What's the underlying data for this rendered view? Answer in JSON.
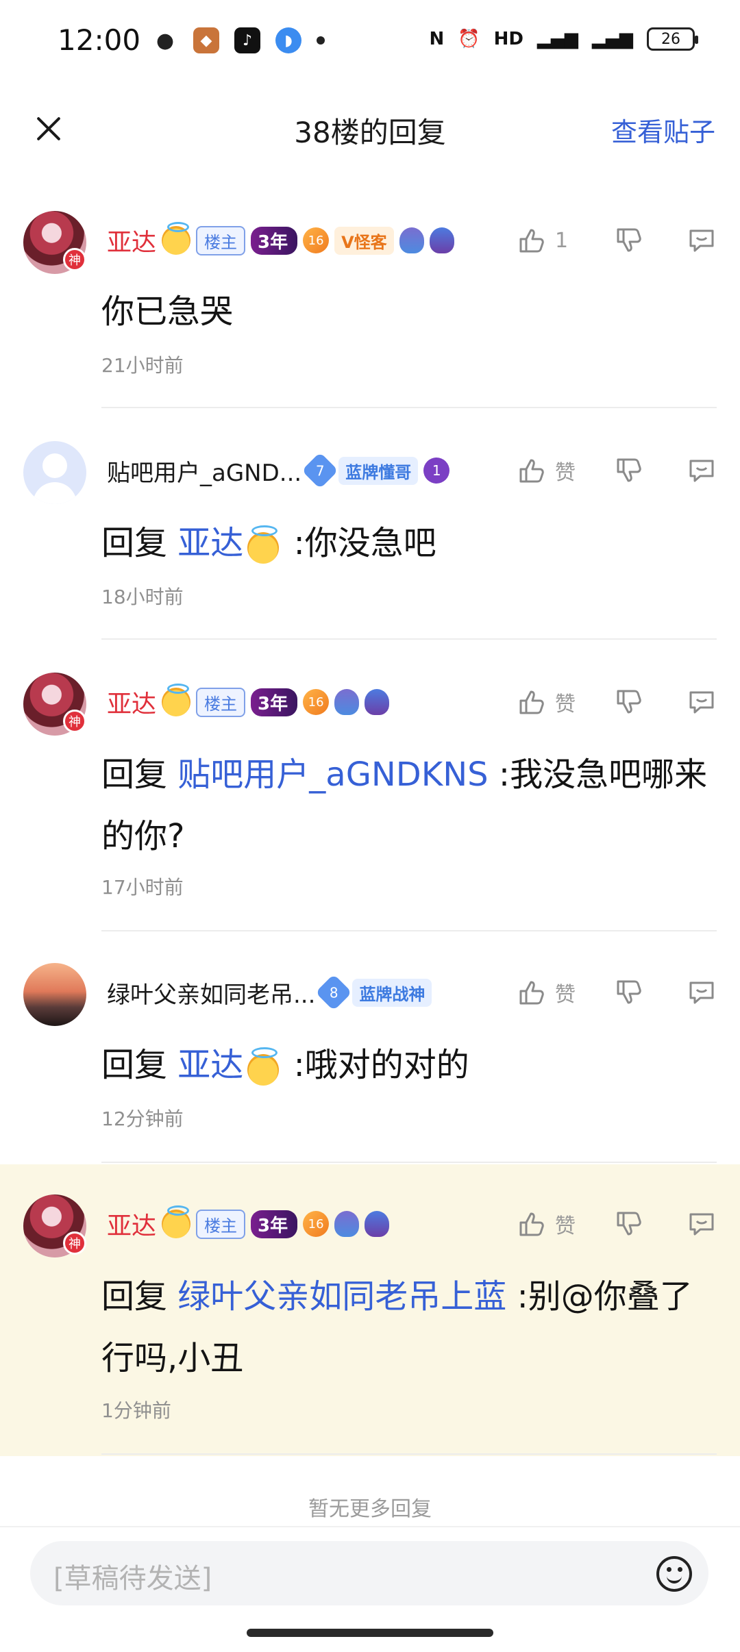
{
  "status_bar": {
    "time": "12:00",
    "battery": "26"
  },
  "header": {
    "title": "38楼的回复",
    "view_post": "查看贴子"
  },
  "replies": [
    {
      "user": "亚达",
      "god_badge": "神",
      "louzhu": "楼主",
      "years": "3年",
      "level": "16",
      "title_tag": "V怪客",
      "like": "1",
      "text": "你已急哭",
      "time": "21小时前"
    },
    {
      "user": "贴吧用户_aGND...",
      "level": "7",
      "title_tag": "蓝牌懂哥",
      "badge_num": "1",
      "like": "赞",
      "reply_prefix": "回复",
      "mention": "亚达",
      "text": ":你没急吧",
      "time": "18小时前"
    },
    {
      "user": "亚达",
      "god_badge": "神",
      "louzhu": "楼主",
      "years": "3年",
      "level": "16",
      "like": "赞",
      "reply_prefix": "回复",
      "mention": "贴吧用户_aGNDKNS",
      "text": ":我没急吧哪来的你?",
      "time": "17小时前"
    },
    {
      "user": "绿叶父亲如同老吊...",
      "level": "8",
      "title_tag": "蓝牌战神",
      "like": "赞",
      "reply_prefix": "回复",
      "mention": "亚达",
      "text": ":哦对的对的",
      "time": "12分钟前"
    },
    {
      "user": "亚达",
      "god_badge": "神",
      "louzhu": "楼主",
      "years": "3年",
      "level": "16",
      "like": "赞",
      "reply_prefix": "回复",
      "mention": "绿叶父亲如同老吊上蓝",
      "text": ":别@你叠了行吗,小丑",
      "time": "1分钟前"
    }
  ],
  "footer": {
    "no_more": "暂无更多回复",
    "input_placeholder": "[草稿待发送]"
  },
  "colors": {
    "accent": "#3660d6",
    "username_red": "#e0303b",
    "highlight_bg": "#fbf7e4"
  }
}
